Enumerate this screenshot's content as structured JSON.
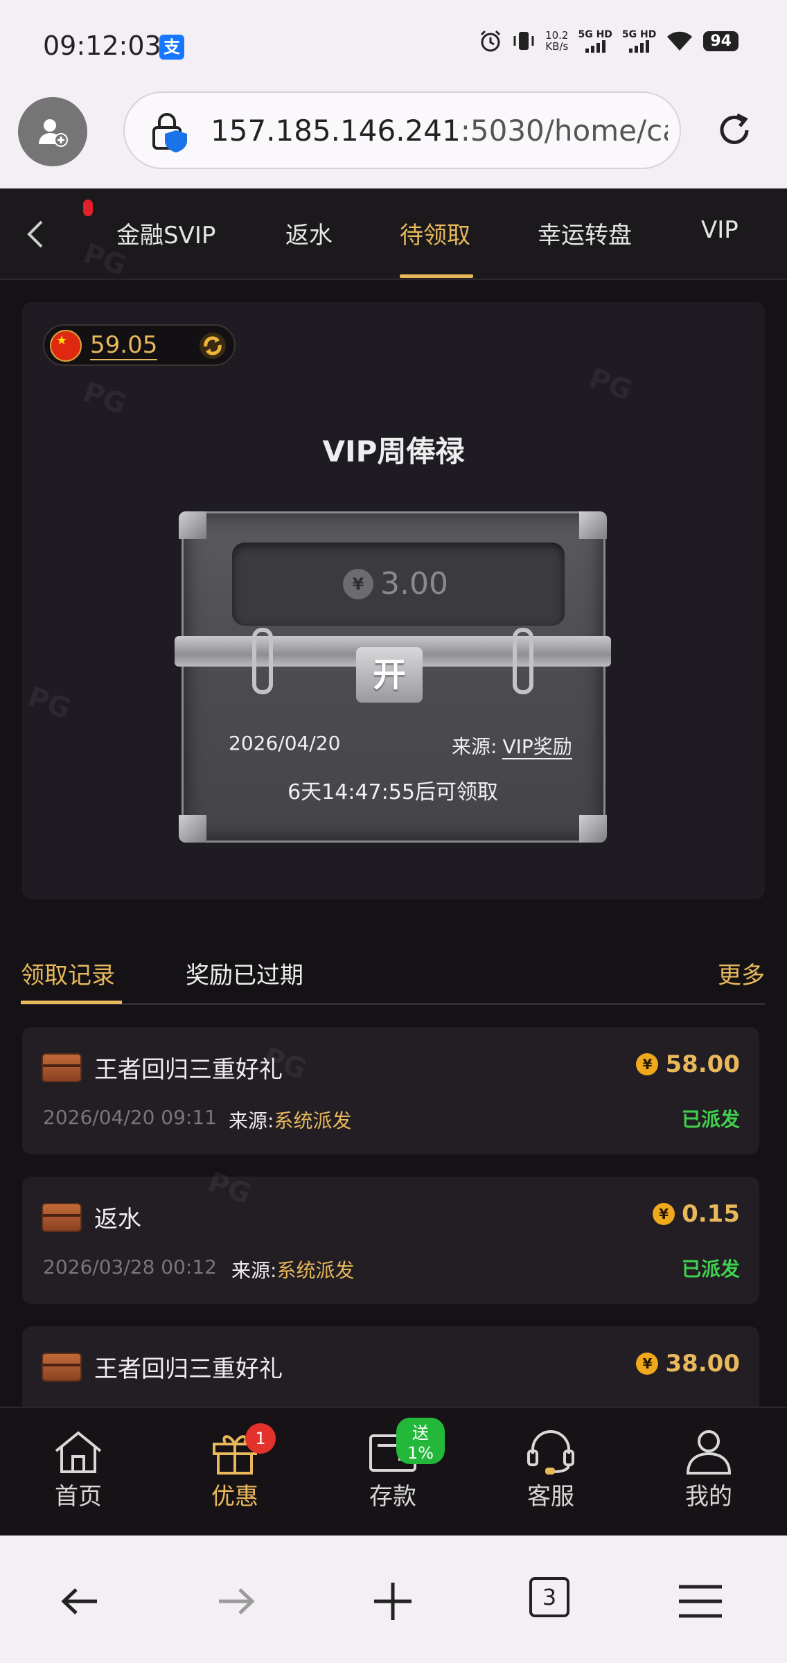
{
  "status_bar": {
    "time": "09:12:03",
    "net_speed_value": "10.2",
    "net_speed_unit": "KB/s",
    "signal1_label": "5G HD",
    "signal2_label": "5G HD",
    "battery": "94"
  },
  "browser": {
    "url_host": "157.185.146.241",
    "url_rest": ":5030/home/ca",
    "tab_count": "3"
  },
  "top_tabs": {
    "items": [
      {
        "label": "金融SVIP"
      },
      {
        "label": "返水"
      },
      {
        "label": "待领取"
      },
      {
        "label": "幸运转盘"
      },
      {
        "label": "VIP"
      }
    ],
    "active_index": 2
  },
  "reward_card": {
    "balance": "59.05",
    "title": "VIP周俸禄",
    "chest_amount": "3.00",
    "yen_symbol": "¥",
    "open_label": "开",
    "date": "2026/04/20",
    "source_label": "来源:",
    "source_value": "VIP奖励",
    "countdown": "6天14:47:55后可领取"
  },
  "record_tabs": {
    "tab1": "领取记录",
    "tab2": "奖励已过期",
    "more": "更多"
  },
  "records": [
    {
      "title": "王者回归三重好礼",
      "amount": "58.00",
      "time": "2026/04/20 09:11",
      "source_label": "来源:",
      "source": "系统派发",
      "status": "已派发"
    },
    {
      "title": "返水",
      "amount": "0.15",
      "time": "2026/03/28 00:12",
      "source_label": "来源:",
      "source": "系统派发",
      "status": "已派发"
    },
    {
      "title": "王者回归三重好礼",
      "amount": "38.00",
      "time": "",
      "source_label": "",
      "source": "",
      "status": ""
    }
  ],
  "bottom_nav": {
    "home": "首页",
    "promo": "优惠",
    "promo_badge": "1",
    "deposit": "存款",
    "deposit_promo": "送1%",
    "service": "客服",
    "mine": "我的"
  },
  "colors": {
    "accent_gold": "#e8b85b",
    "status_green": "#3fd14d",
    "badge_red": "#e3312c",
    "background": "#151216"
  }
}
